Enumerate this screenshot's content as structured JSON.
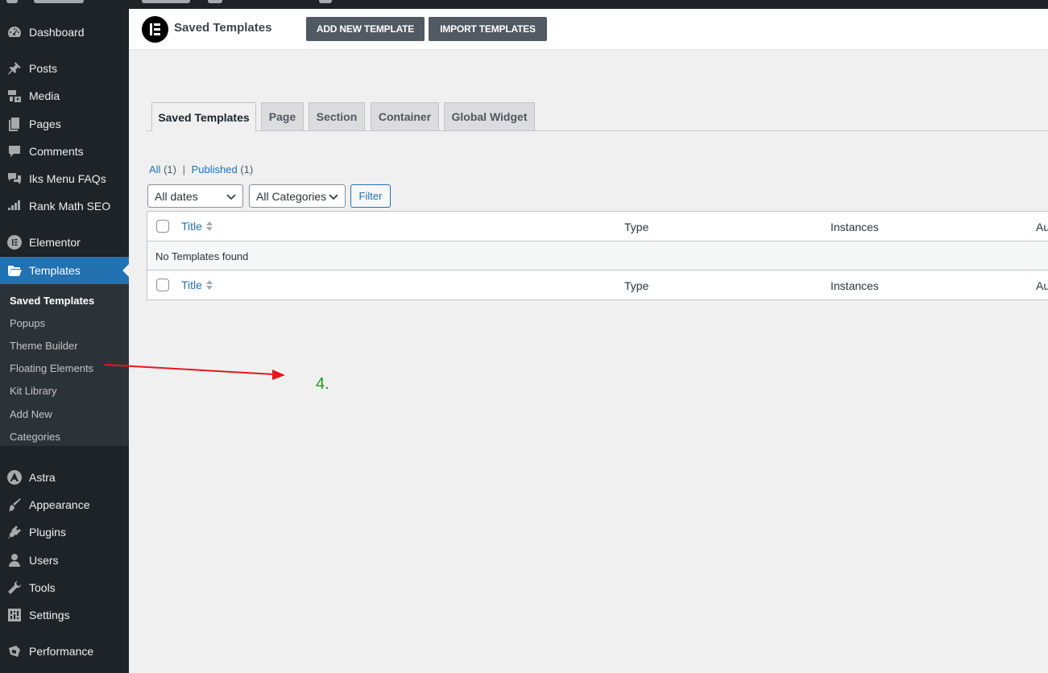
{
  "sidebar": {
    "items": [
      {
        "label": "Dashboard",
        "icon": "dashboard-icon"
      },
      {
        "label": "Posts",
        "icon": "pin-icon"
      },
      {
        "label": "Media",
        "icon": "media-icon"
      },
      {
        "label": "Pages",
        "icon": "pages-icon"
      },
      {
        "label": "Comments",
        "icon": "comments-icon"
      },
      {
        "label": "Iks Menu FAQs",
        "icon": "faq-icon"
      },
      {
        "label": "Rank Math SEO",
        "icon": "rankmath-icon"
      },
      {
        "label": "Elementor",
        "icon": "elementor-icon"
      },
      {
        "label": "Templates",
        "icon": "folder-icon",
        "current": true
      },
      {
        "label": "Astra",
        "icon": "astra-icon"
      },
      {
        "label": "Appearance",
        "icon": "brush-icon"
      },
      {
        "label": "Plugins",
        "icon": "plugin-icon"
      },
      {
        "label": "Users",
        "icon": "users-icon"
      },
      {
        "label": "Tools",
        "icon": "wrench-icon"
      },
      {
        "label": "Settings",
        "icon": "settings-icon"
      },
      {
        "label": "Performance",
        "icon": "performance-icon"
      }
    ],
    "submenu": [
      {
        "label": "Saved Templates",
        "current": true
      },
      {
        "label": "Popups"
      },
      {
        "label": "Theme Builder"
      },
      {
        "label": "Floating Elements"
      },
      {
        "label": "Kit Library"
      },
      {
        "label": "Add New"
      },
      {
        "label": "Categories"
      }
    ]
  },
  "header": {
    "title": "Saved Templates",
    "add_button": "ADD NEW TEMPLATE",
    "import_button": "IMPORT TEMPLATES"
  },
  "tabs": [
    {
      "label": "Saved Templates",
      "active": true
    },
    {
      "label": "Page"
    },
    {
      "label": "Section"
    },
    {
      "label": "Container"
    },
    {
      "label": "Global Widget"
    }
  ],
  "views": {
    "all_label": "All",
    "all_count": "(1)",
    "separator": "|",
    "published_label": "Published",
    "published_count": "(1)"
  },
  "filters": {
    "dates": "All dates",
    "categories": "All Categories",
    "filter_button": "Filter"
  },
  "table": {
    "columns": {
      "title": "Title",
      "type": "Type",
      "instances": "Instances",
      "author": "Au"
    },
    "empty_message": "No Templates found"
  },
  "annotation": {
    "label": "4.",
    "color": "#1a9c1a"
  },
  "colors": {
    "accent": "#2271b1",
    "sidebar": "#1d2327",
    "arrow": "#e8161b"
  }
}
